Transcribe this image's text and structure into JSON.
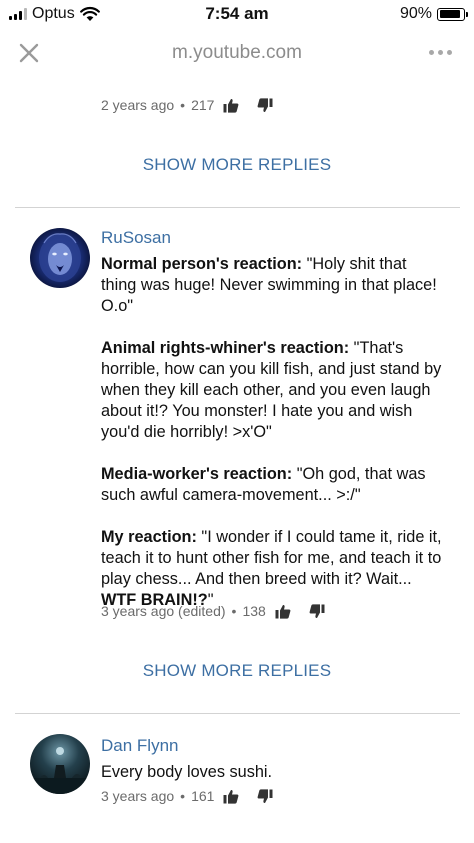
{
  "status_bar": {
    "carrier": "Optus",
    "time": "7:54 am",
    "battery_percent": "90%",
    "battery_level": 0.9,
    "signal_icon": "signal-bars-icon",
    "wifi_icon": "wifi-icon",
    "battery_icon": "battery-icon"
  },
  "browser": {
    "url": "m.youtube.com",
    "close_icon": "close-icon",
    "more_icon": "more-options-icon"
  },
  "top_reply": {
    "time": "2 years ago",
    "separator": "•",
    "likes": "217"
  },
  "show_more_1": "SHOW MORE REPLIES",
  "comments": [
    {
      "author": "RuSosan",
      "avatar": "lion-avatar",
      "paragraphs": [
        {
          "bold": "Normal person's reaction:",
          "text": " \"Holy shit that thing was huge! Never swimming in that place! O.o\""
        },
        {
          "bold": "Animal rights-whiner's reaction:",
          "text": " \"That's horrible, how can you kill fish, and just stand by when they kill each other, and you even laugh about it!? You monster! I hate you and wish you'd die horribly! >x'O\""
        },
        {
          "bold": "Media-worker's reaction:",
          "text": " \"Oh god, that was such awful camera-movement... >:/\""
        },
        {
          "bold": "My reaction:",
          "text": " \"I wonder if I could tame it, ride it, teach it to hunt other fish for me, and teach it to play chess... And then breed with it? Wait... ",
          "bold_end": "WTF BRAIN!?",
          "text_end": "\""
        }
      ],
      "time": "3 years ago (edited)",
      "separator": "•",
      "likes": "138"
    },
    {
      "author": "Dan Flynn",
      "avatar": "night-scene-avatar",
      "text": "Every body loves sushi.",
      "time": "3 years ago",
      "separator": "•",
      "likes": "161"
    }
  ],
  "show_more_2": "SHOW MORE REPLIES",
  "colors": {
    "link_blue": "#3d6fa3",
    "meta_gray": "#6b6b6b",
    "divider": "#d3d3d3"
  }
}
